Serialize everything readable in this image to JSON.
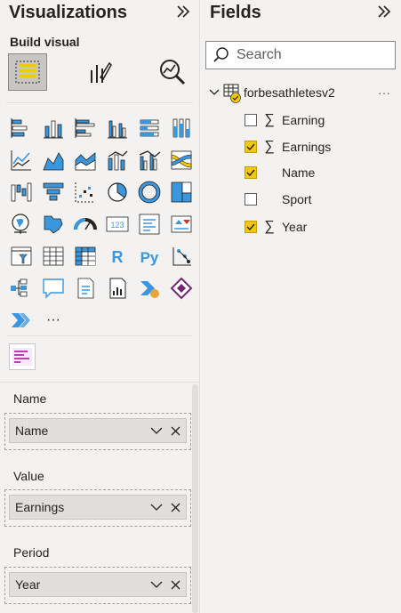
{
  "visualizations": {
    "title": "Visualizations",
    "build_visual_label": "Build visual",
    "more_visuals": "···",
    "wells": [
      {
        "title": "Name",
        "value": "Name"
      },
      {
        "title": "Value",
        "value": "Earnings"
      },
      {
        "title": "Period",
        "value": "Year"
      }
    ]
  },
  "fields": {
    "title": "Fields",
    "search_placeholder": "Search",
    "table_name": "forbesathletesv2",
    "more": "···",
    "items": [
      {
        "label": "Earning",
        "checked": false,
        "sigma": true
      },
      {
        "label": "Earnings",
        "checked": true,
        "sigma": true
      },
      {
        "label": "Name",
        "checked": true,
        "sigma": false
      },
      {
        "label": "Sport",
        "checked": false,
        "sigma": false
      },
      {
        "label": "Year",
        "checked": true,
        "sigma": true
      }
    ]
  },
  "colors": {
    "accent": "#f2c80f",
    "icon_blue": "#3a96dd",
    "icon_dark": "#252423"
  }
}
